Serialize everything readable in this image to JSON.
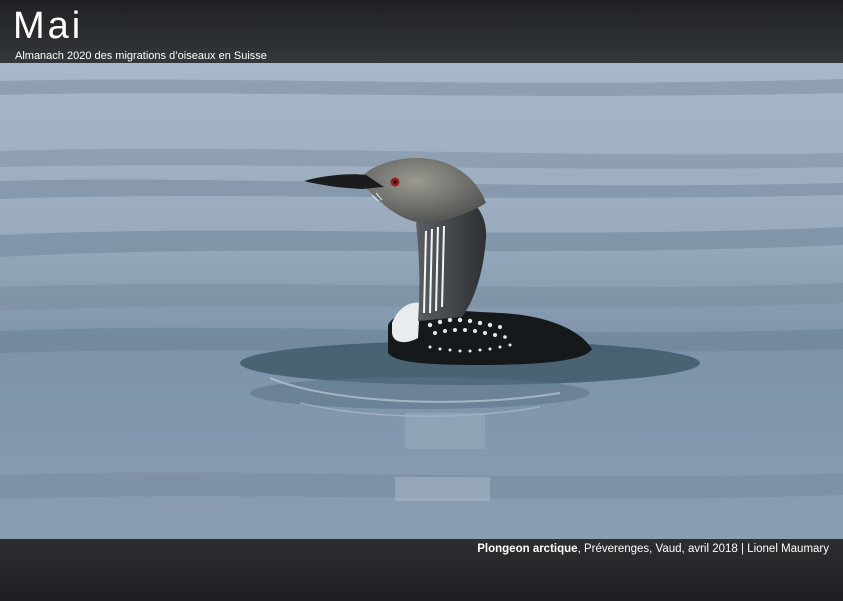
{
  "header": {
    "month": "Mai",
    "subtitle": "Almanach 2020 des migrations d’oiseaux en Suisse"
  },
  "photo": {
    "subject_icon": "loon-icon"
  },
  "footer": {
    "species": "Plongeon arctique",
    "details": ", Préverenges, Vaud, avril 2018 | Lionel Maumary"
  },
  "colors": {
    "water": "#93a5b7",
    "bar": "#2a2c2f",
    "text": "#ffffff"
  }
}
